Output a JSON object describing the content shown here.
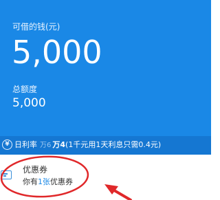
{
  "loan": {
    "available_label": "可借的钱(元)",
    "available_amount": "5,000",
    "total_label": "总额度",
    "total_amount": "5,000"
  },
  "rate": {
    "label": "日利率",
    "old_value": "万6",
    "new_value": "万4",
    "note": "(1千元用1天利息只需0.4元)"
  },
  "coupon": {
    "title": "优惠券",
    "desc_prefix": "你有",
    "count": "1张",
    "desc_suffix": "优惠券"
  },
  "colors": {
    "primary": "#1a88e6",
    "rate_bar": "#1577d2",
    "annotation": "#e0282a"
  }
}
